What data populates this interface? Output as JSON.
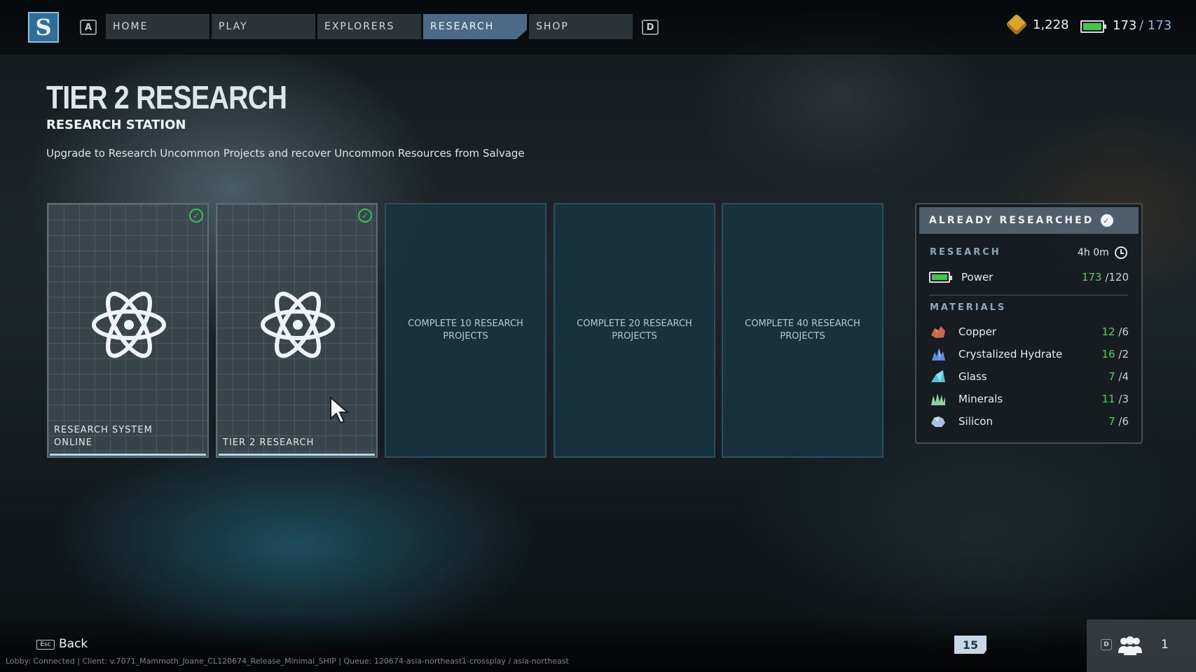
{
  "nav": {
    "logo_letter": "S",
    "left_key": "A",
    "right_key": "D",
    "tabs": [
      {
        "label": "HOME",
        "active": false
      },
      {
        "label": "PLAY",
        "active": false
      },
      {
        "label": "EXPLORERS",
        "active": false
      },
      {
        "label": "RESEARCH",
        "active": true
      },
      {
        "label": "SHOP",
        "active": false
      }
    ]
  },
  "currency": {
    "icon": "gold-gem-icon",
    "value": "1,228"
  },
  "energy": {
    "icon": "battery-icon",
    "current": "173",
    "max": "/ 173",
    "fill_fraction": 1.0,
    "color": "#3ec84b"
  },
  "header": {
    "title": "TIER 2 RESEARCH",
    "subtitle": "RESEARCH STATION",
    "description": "Upgrade to Research Uncommon Projects and recover Uncommon Resources from Salvage"
  },
  "tiers": [
    {
      "label": "RESEARCH SYSTEM ONLINE",
      "state": "completed",
      "icon": "atom-icon"
    },
    {
      "label": "TIER 2 RESEARCH",
      "state": "completed",
      "icon": "atom-icon"
    },
    {
      "label": "COMPLETE 10 RESEARCH PROJECTS",
      "state": "locked"
    },
    {
      "label": "COMPLETE 20 RESEARCH PROJECTS",
      "state": "locked"
    },
    {
      "label": "COMPLETE 40 RESEARCH PROJECTS",
      "state": "locked"
    }
  ],
  "panel": {
    "status": "ALREADY RESEARCHED",
    "research_label": "RESEARCH",
    "time": "4h 0m",
    "power": {
      "name": "Power",
      "have": "173",
      "need": "/120"
    },
    "materials_label": "MATERIALS",
    "materials": [
      {
        "name": "Copper",
        "have": "12",
        "need": "/6",
        "icon": "copper-icon",
        "color": "#c9694a"
      },
      {
        "name": "Crystalized Hydrate",
        "have": "16",
        "need": "/2",
        "icon": "hydrate-crystal-icon",
        "color": "#5b8fe0"
      },
      {
        "name": "Glass",
        "have": "7",
        "need": "/4",
        "icon": "glass-icon",
        "color": "#4fc2d8"
      },
      {
        "name": "Minerals",
        "have": "11",
        "need": "/3",
        "icon": "minerals-icon",
        "color": "#8fd3a0"
      },
      {
        "name": "Silicon",
        "have": "7",
        "need": "/6",
        "icon": "silicon-icon",
        "color": "#a9c2e6"
      }
    ]
  },
  "footer": {
    "esc_key": "Esc",
    "back_label": "Back",
    "status_line": "Lobby: Connected | Client: v.7071_Mammoth_Joane_CL120674_Release_Minimal_SHIP | Queue: 120674-asia-northeast1-crossplay / asia-northeast",
    "level": "15",
    "party_key": "D",
    "party_count": "1"
  },
  "colors": {
    "accent": "#4c6a85",
    "positive": "#4fd161",
    "check": "#34c05a"
  }
}
